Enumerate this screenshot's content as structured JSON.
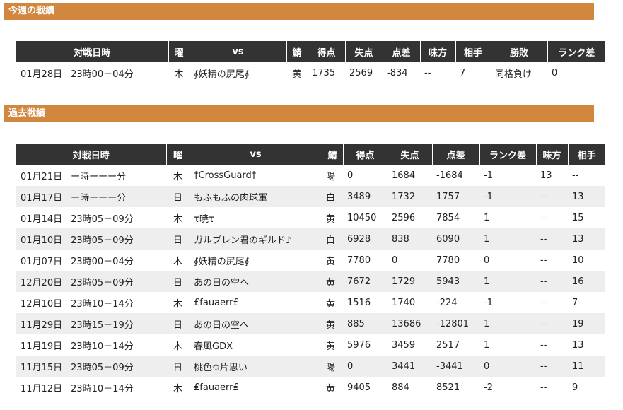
{
  "this_week": {
    "title": "今週の戦績",
    "headers": [
      "対戦日時",
      "曜",
      "vs",
      "鯖",
      "得点",
      "失点",
      "点差",
      "味方",
      "相手",
      "勝敗",
      "ランク差"
    ],
    "rows": [
      {
        "date": "01月28日",
        "time": "23時00－04分",
        "day": "木",
        "vs": "∮妖精の尻尾∮",
        "server": "黄",
        "score": "1735",
        "lost": "2569",
        "diff": "-834",
        "ally": "--",
        "enemy": "7",
        "result": "同格負け",
        "rank_diff": "0"
      }
    ]
  },
  "past": {
    "title": "過去戦績",
    "headers": [
      "対戦日時",
      "曜",
      "vs",
      "鯖",
      "得点",
      "失点",
      "点差",
      "ランク差",
      "味方",
      "相手"
    ],
    "rows": [
      {
        "date": "01月21日",
        "time": "ー時ーーー分",
        "day": "木",
        "vs": "†CrossGuard†",
        "server": "陽",
        "score": "0",
        "lost": "1684",
        "diff": "-1684",
        "rank_diff": "-1",
        "ally": "13",
        "enemy": "--"
      },
      {
        "date": "01月17日",
        "time": "ー時ーーー分",
        "day": "日",
        "vs": "もふもふの肉球軍",
        "server": "白",
        "score": "3489",
        "lost": "1732",
        "diff": "1757",
        "rank_diff": "-1",
        "ally": "--",
        "enemy": "13"
      },
      {
        "date": "01月14日",
        "time": "23時05－09分",
        "day": "木",
        "vs": "τ暁τ",
        "server": "黄",
        "score": "10450",
        "lost": "2596",
        "diff": "7854",
        "rank_diff": "1",
        "ally": "--",
        "enemy": "15"
      },
      {
        "date": "01月10日",
        "time": "23時05－09分",
        "day": "日",
        "vs": "ガルブレン君のギルド♪",
        "server": "白",
        "score": "6928",
        "lost": "838",
        "diff": "6090",
        "rank_diff": "1",
        "ally": "--",
        "enemy": "13"
      },
      {
        "date": "01月07日",
        "time": "23時00－04分",
        "day": "木",
        "vs": "∮妖精の尻尾∮",
        "server": "黄",
        "score": "7780",
        "lost": "0",
        "diff": "7780",
        "rank_diff": "0",
        "ally": "--",
        "enemy": "10"
      },
      {
        "date": "12月20日",
        "time": "23時05－09分",
        "day": "日",
        "vs": "あの日の空へ",
        "server": "黄",
        "score": "7672",
        "lost": "1729",
        "diff": "5943",
        "rank_diff": "1",
        "ally": "--",
        "enemy": "16"
      },
      {
        "date": "12月10日",
        "time": "23時10－14分",
        "day": "木",
        "vs": "₤fauaerr₤",
        "server": "黄",
        "score": "1516",
        "lost": "1740",
        "diff": "-224",
        "rank_diff": "-1",
        "ally": "--",
        "enemy": "7"
      },
      {
        "date": "11月29日",
        "time": "23時15－19分",
        "day": "日",
        "vs": "あの日の空へ",
        "server": "黄",
        "score": "885",
        "lost": "13686",
        "diff": "-12801",
        "rank_diff": "1",
        "ally": "--",
        "enemy": "19"
      },
      {
        "date": "11月19日",
        "time": "23時10－14分",
        "day": "木",
        "vs": "春風GDX",
        "server": "黄",
        "score": "5976",
        "lost": "3459",
        "diff": "2517",
        "rank_diff": "1",
        "ally": "--",
        "enemy": "13"
      },
      {
        "date": "11月15日",
        "time": "23時05－09分",
        "day": "日",
        "vs": "桃色✩片思い",
        "server": "陽",
        "score": "0",
        "lost": "3441",
        "diff": "-3441",
        "rank_diff": "0",
        "ally": "--",
        "enemy": "11"
      },
      {
        "date": "11月12日",
        "time": "23時10－14分",
        "day": "木",
        "vs": "₤fauaerr₤",
        "server": "黄",
        "score": "9405",
        "lost": "884",
        "diff": "8521",
        "rank_diff": "-2",
        "ally": "--",
        "enemy": "9"
      }
    ]
  }
}
